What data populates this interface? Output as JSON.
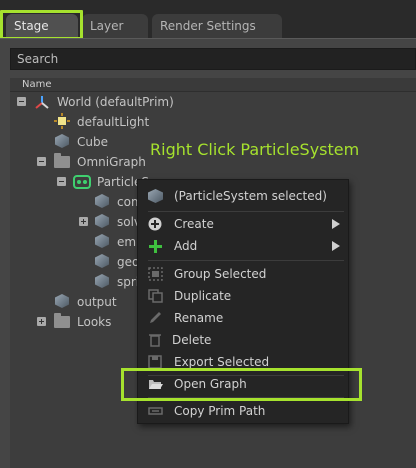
{
  "tabs": [
    {
      "label": "Stage",
      "active": true
    },
    {
      "label": "Layer",
      "active": false
    },
    {
      "label": "Render Settings",
      "active": false
    }
  ],
  "search": {
    "placeholder": "Search"
  },
  "tree": {
    "header": "Name",
    "items": [
      {
        "label": "World (defaultPrim)",
        "icon": "axes-icon",
        "expanded": true
      },
      {
        "label": "defaultLight",
        "icon": "light-icon"
      },
      {
        "label": "Cube",
        "icon": "cube-icon"
      },
      {
        "label": "OmniGraph",
        "icon": "folder-icon",
        "expanded": true
      },
      {
        "label": "ParticleS",
        "icon": "particle-system-icon",
        "expanded": true
      },
      {
        "label": "com",
        "icon": "cube-icon"
      },
      {
        "label": "solv",
        "icon": "cube-icon",
        "expanded": false
      },
      {
        "label": "emi",
        "icon": "cube-icon"
      },
      {
        "label": "geo",
        "icon": "cube-icon"
      },
      {
        "label": "spri",
        "icon": "cube-icon"
      },
      {
        "label": "output",
        "icon": "cube-icon"
      },
      {
        "label": "Looks",
        "icon": "folder-icon",
        "expanded": false
      }
    ]
  },
  "annotation": "Right Click ParticleSystem",
  "context_menu": {
    "items": [
      {
        "label": "(ParticleSystem selected)",
        "icon": "cube-icon"
      },
      {
        "label": "Create",
        "icon": "plus-circle-icon",
        "submenu": true
      },
      {
        "label": "Add",
        "icon": "plus-icon",
        "submenu": true
      },
      {
        "label": "Group Selected",
        "icon": "group-icon"
      },
      {
        "label": "Duplicate",
        "icon": "duplicate-icon"
      },
      {
        "label": "Rename",
        "icon": "pencil-icon"
      },
      {
        "label": "Delete",
        "icon": "trash-icon"
      },
      {
        "label": "Export Selected",
        "icon": "save-icon"
      },
      {
        "label": "Open Graph",
        "icon": "folder-open-icon"
      },
      {
        "label": "Copy Prim Path",
        "icon": "copy-path-icon"
      }
    ]
  },
  "colors": {
    "highlight": "#a6e22e",
    "panel": "#454545",
    "menu": "#252525"
  }
}
